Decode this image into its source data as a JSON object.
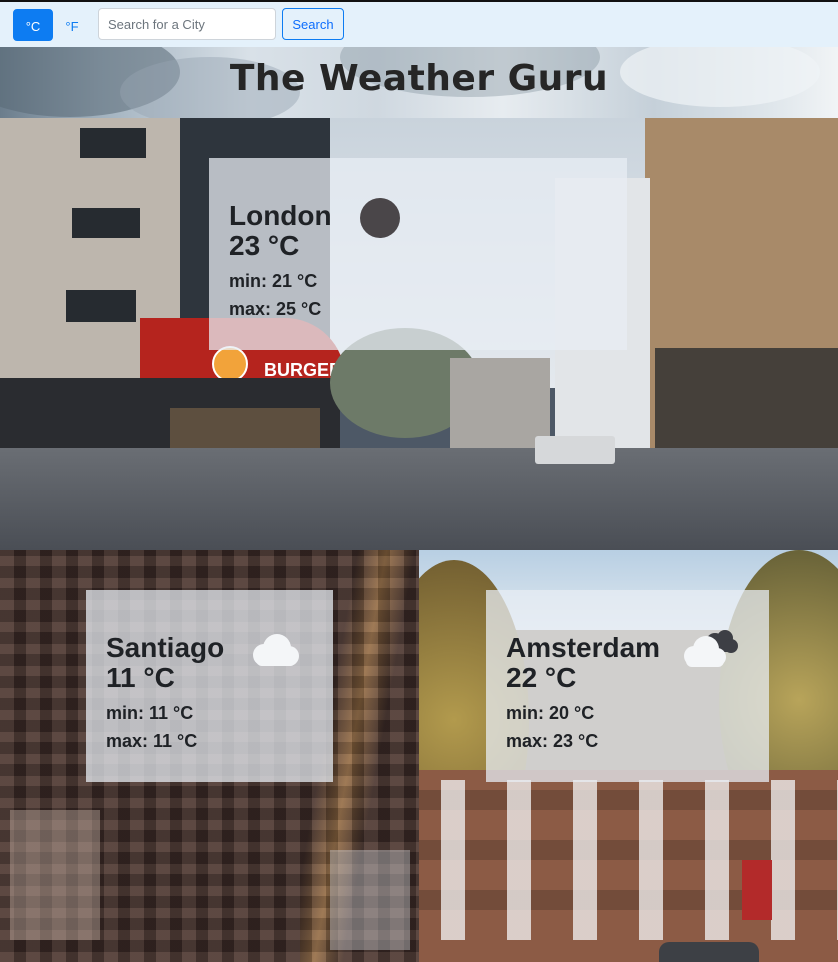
{
  "controls": {
    "celsius_label": "°C",
    "fahrenheit_label": "°F",
    "search_placeholder": "Search for a City",
    "search_value": "",
    "search_button_label": "Search",
    "active_unit": "celsius",
    "accent_color": "#0d7cf2"
  },
  "header": {
    "title": "The Weather Guru"
  },
  "cards": {
    "london": {
      "city": "London",
      "temp": "23 °C",
      "min": "min: 21 °C",
      "max": "max: 25 °C",
      "icon": "clear-night-moon-icon"
    },
    "santiago": {
      "city": "Santiago",
      "temp": "11 °C",
      "min": "min: 11 °C",
      "max": "max: 11 °C",
      "icon": "cloud-icon"
    },
    "amsterdam": {
      "city": "Amsterdam",
      "temp": "22 °C",
      "min": "min: 20 °C",
      "max": "max: 23 °C",
      "icon": "cloudy-icon"
    }
  },
  "photo_signage": {
    "burger_king_sign": "BURGER KING"
  }
}
